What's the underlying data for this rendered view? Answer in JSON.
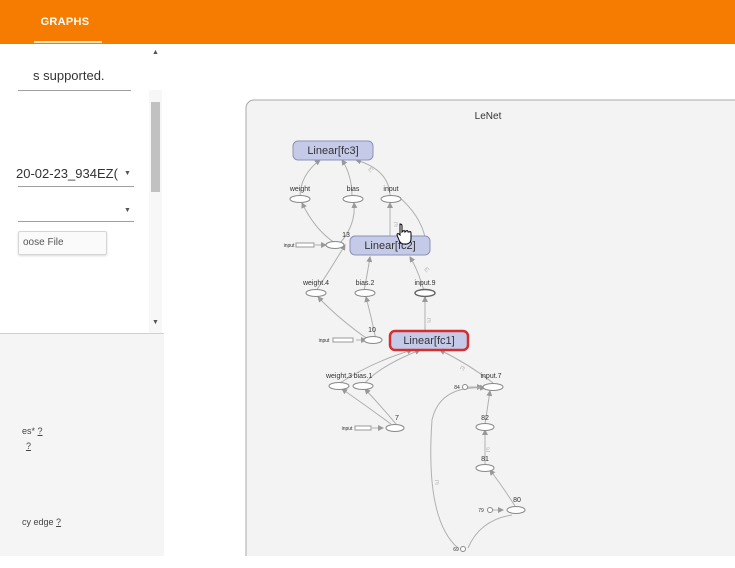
{
  "header": {
    "tabs": [
      {
        "label": "GRAPHS",
        "selected": true
      }
    ],
    "color": "#f57c00"
  },
  "sidebar": {
    "supported_text": "s supported.",
    "run_value": "20-02-23_934EZ(",
    "choose_file_label": "oose File",
    "help_items": [
      {
        "label": "es*",
        "q": "?"
      },
      {
        "label": "",
        "q": "?"
      },
      {
        "label": "cy edge",
        "q": "?"
      }
    ]
  },
  "graph": {
    "title": "LeNet",
    "nodes": {
      "fc3": "Linear[fc3]",
      "fc2": "Linear[fc2]",
      "fc1": "Linear[fc1]"
    },
    "labels": {
      "weight": "weight",
      "bias": "bias",
      "input": "input",
      "n13": "13",
      "input_left_1": "input",
      "weight4": "weight.4",
      "bias2": "bias.2",
      "input9": "input.9",
      "n10": "10",
      "input_left_2": "input",
      "weight3": "weight.3",
      "bias1": "bias.1",
      "input7": "input.7",
      "n84": "84",
      "n7": "7",
      "input_left_3": "input",
      "n82": "82",
      "n81": "81",
      "n80": "80",
      "n79": "79",
      "n69": "69"
    }
  }
}
